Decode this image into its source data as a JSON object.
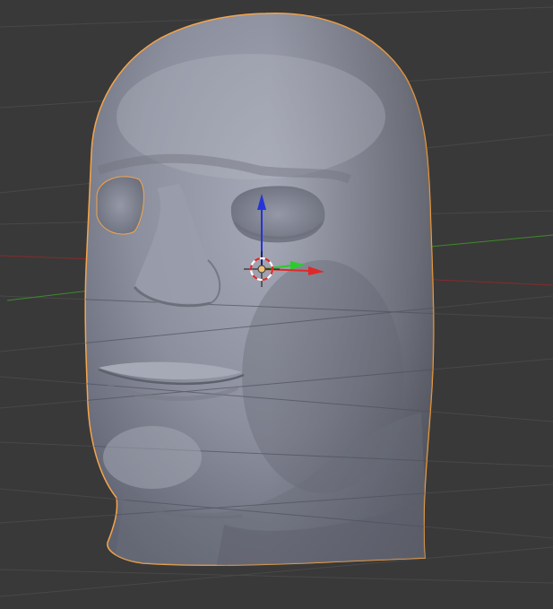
{
  "viewport": {
    "background": "#393939",
    "grid_color": "#4a4a4a",
    "axis_x_color": "#8a2a2a",
    "axis_y_color": "#3f8a2a",
    "grid": true
  },
  "object": {
    "kind": "head-mesh",
    "selected": true,
    "selection_outline_color": "#f5a54a",
    "surface_color": "#8b8e9c"
  },
  "gizmo": {
    "x_color": "#e0282a",
    "y_color": "#2ccb2c",
    "z_color": "#2434d8",
    "cursor_colors": [
      "#e0282a",
      "#ffffff"
    ]
  }
}
